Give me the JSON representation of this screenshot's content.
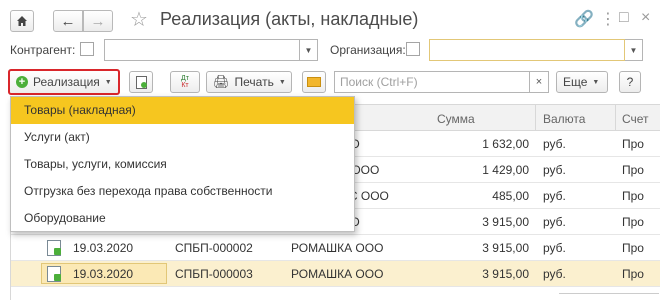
{
  "window": {
    "title": "Реализация (акты, накладные)"
  },
  "filters": {
    "counterparty_label": "Контрагент:",
    "organization_label": "Организация:",
    "counterparty_value": "",
    "organization_value": ""
  },
  "toolbar": {
    "realization_label": "Реализация",
    "print_label": "Печать",
    "more_label": "Еще",
    "help_label": "?",
    "search_placeholder": "Поиск (Ctrl+F)",
    "clear_label": "×"
  },
  "menu": {
    "items": [
      "Товары (накладная)",
      "Услуги (акт)",
      "Товары, услуги, комиссия",
      "Отгрузка без перехода права собственности",
      "Оборудование"
    ]
  },
  "table": {
    "columns": [
      "Сумма",
      "Валюта",
      "Счет"
    ],
    "rows": [
      {
        "date": "",
        "number": "",
        "counterparty": "ОО",
        "amount": "1 632,00",
        "currency": "руб.",
        "status": "Про"
      },
      {
        "date": "",
        "number": "",
        "counterparty": "К ООО",
        "amount": "1 429,00",
        "currency": "руб.",
        "status": "Про"
      },
      {
        "date": "",
        "number": "",
        "counterparty": "РС ООО",
        "amount": "485,00",
        "currency": "руб.",
        "status": "Про"
      },
      {
        "date": "",
        "number": "",
        "counterparty": "ОО",
        "amount": "3 915,00",
        "currency": "руб.",
        "status": "Про"
      },
      {
        "date": "19.03.2020",
        "number": "СПБП-000002",
        "counterparty": "РОМАШКА ООО",
        "amount": "3 915,00",
        "currency": "руб.",
        "status": "Про"
      },
      {
        "date": "19.03.2020",
        "number": "СПБП-000003",
        "counterparty": "РОМАШКА ООО",
        "amount": "3 915,00",
        "currency": "руб.",
        "status": "Про"
      }
    ]
  },
  "icons": {
    "home": "home-icon",
    "back": "arrow-left-icon",
    "forward": "arrow-right-icon",
    "star": "star-icon",
    "link": "link-icon",
    "menu": "more-vertical-icon",
    "maximize": "maximize-icon",
    "close": "close-icon"
  },
  "colors": {
    "menu_highlight": "#f6c61f",
    "selected_row": "#fbf0cf",
    "red_outline": "#d9262b"
  }
}
